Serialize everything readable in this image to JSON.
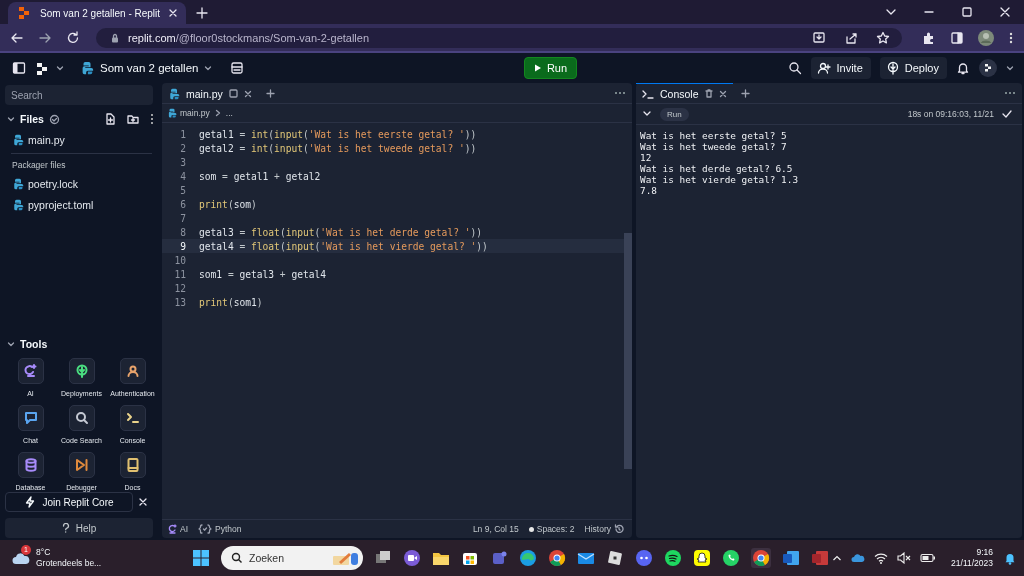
{
  "browser": {
    "tab_title": "Som van 2 getallen - Replit",
    "url_host": "replit.com",
    "url_path": "/@floor0stockmans/Som-van-2-getallen"
  },
  "header": {
    "project": "Som van 2 getallen",
    "run_button": "Run",
    "invite_button": "Invite",
    "deploy_button": "Deploy"
  },
  "sidebar": {
    "search_placeholder": "Search",
    "files_title": "Files",
    "files": [
      {
        "name": "main.py"
      }
    ],
    "packager_title": "Packager files",
    "packager_files": [
      {
        "name": "poetry.lock"
      },
      {
        "name": "pyproject.toml"
      }
    ],
    "tools_title": "Tools",
    "tools": [
      {
        "label": "AI",
        "kind": "ai",
        "color": "#a78bfa"
      },
      {
        "label": "Deployments",
        "kind": "deployments",
        "color": "#4ade80"
      },
      {
        "label": "Authentication",
        "kind": "authentication",
        "color": "#e8a36b"
      },
      {
        "label": "Chat",
        "kind": "chat",
        "color": "#5aa5f0"
      },
      {
        "label": "Code Search",
        "kind": "search",
        "color": "#c5c9d3"
      },
      {
        "label": "Console",
        "kind": "console",
        "color": "#e9d28a"
      },
      {
        "label": "Database",
        "kind": "database",
        "color": "#a78bfa"
      },
      {
        "label": "Debugger",
        "kind": "debugger",
        "color": "#e08a3c"
      },
      {
        "label": "Docs",
        "kind": "docs",
        "color": "#e0c070"
      }
    ],
    "join_button": "Join Replit Core",
    "help_button": "Help"
  },
  "editor": {
    "tab": "main.py",
    "breadcrumb_file": "main.py",
    "breadcrumb_more": "...",
    "lines": [
      {
        "number": "1",
        "current": false,
        "tokens": [
          {
            "text": "getal1",
            "kind": "name"
          },
          {
            "text": " = ",
            "kind": "op"
          },
          {
            "text": "int",
            "kind": "func"
          },
          {
            "text": "(",
            "kind": "op"
          },
          {
            "text": "input",
            "kind": "func"
          },
          {
            "text": "(",
            "kind": "op"
          },
          {
            "text": "'Wat is het eerste getal? '",
            "kind": "string"
          },
          {
            "text": "))",
            "kind": "op"
          }
        ]
      },
      {
        "number": "2",
        "current": false,
        "tokens": [
          {
            "text": "getal2",
            "kind": "name"
          },
          {
            "text": " = ",
            "kind": "op"
          },
          {
            "text": "int",
            "kind": "func"
          },
          {
            "text": "(",
            "kind": "op"
          },
          {
            "text": "input",
            "kind": "func"
          },
          {
            "text": "(",
            "kind": "op"
          },
          {
            "text": "'Wat is het tweede getal? '",
            "kind": "string"
          },
          {
            "text": "))",
            "kind": "op"
          }
        ]
      },
      {
        "number": "3",
        "current": false
      },
      {
        "number": "4",
        "current": false,
        "tokens": [
          {
            "text": "som",
            "kind": "name"
          },
          {
            "text": " = ",
            "kind": "op"
          },
          {
            "text": "getal1",
            "kind": "name"
          },
          {
            "text": " + ",
            "kind": "op"
          },
          {
            "text": "getal2",
            "kind": "name"
          }
        ]
      },
      {
        "number": "5",
        "current": false
      },
      {
        "number": "6",
        "current": false,
        "tokens": [
          {
            "text": "print",
            "kind": "func"
          },
          {
            "text": "(",
            "kind": "op"
          },
          {
            "text": "som",
            "kind": "name"
          },
          {
            "text": ")",
            "kind": "op"
          }
        ]
      },
      {
        "number": "7",
        "current": false
      },
      {
        "number": "8",
        "current": false,
        "tokens": [
          {
            "text": "getal3",
            "kind": "name"
          },
          {
            "text": " = ",
            "kind": "op"
          },
          {
            "text": "float",
            "kind": "func"
          },
          {
            "text": "(",
            "kind": "op"
          },
          {
            "text": "input",
            "kind": "func"
          },
          {
            "text": "(",
            "kind": "op"
          },
          {
            "text": "'Wat is het derde getal? '",
            "kind": "string"
          },
          {
            "text": "))",
            "kind": "op"
          }
        ]
      },
      {
        "number": "9",
        "current": true,
        "tokens": [
          {
            "text": "getal4",
            "kind": "name"
          },
          {
            "text": " = ",
            "kind": "op"
          },
          {
            "text": "float",
            "kind": "func"
          },
          {
            "text": "(",
            "kind": "op"
          },
          {
            "text": "input",
            "kind": "func"
          },
          {
            "text": "(",
            "kind": "op"
          },
          {
            "text": "'Wat is het vierde getal? '",
            "kind": "string"
          },
          {
            "text": "))",
            "kind": "op"
          }
        ]
      },
      {
        "number": "10",
        "current": false
      },
      {
        "number": "11",
        "current": false,
        "tokens": [
          {
            "text": "som1",
            "kind": "name"
          },
          {
            "text": " = ",
            "kind": "op"
          },
          {
            "text": "getal3",
            "kind": "name"
          },
          {
            "text": " + ",
            "kind": "op"
          },
          {
            "text": "getal4",
            "kind": "name"
          }
        ]
      },
      {
        "number": "12",
        "current": false
      },
      {
        "number": "13",
        "current": false,
        "tokens": [
          {
            "text": "print",
            "kind": "func"
          },
          {
            "text": "(",
            "kind": "op"
          },
          {
            "text": "som1",
            "kind": "name"
          },
          {
            "text": ")",
            "kind": "op"
          }
        ]
      }
    ],
    "status": {
      "ai": "AI",
      "language": "Python",
      "position": "Ln 9, Col 15",
      "spaces": "Spaces: 2",
      "history": "History"
    }
  },
  "console": {
    "tab": "Console",
    "run_chip": "Run",
    "run_info": "18s on 09:16:03, 11/21",
    "output": [
      "Wat is het eerste getal? 5",
      "Wat is het tweede getal? 7",
      "12",
      "Wat is het derde getal? 6.5",
      "Wat is het vierde getal? 1.3",
      "7.8"
    ]
  },
  "taskbar": {
    "weather_badge": "1",
    "temperature": "8°C",
    "weather_text": "Grotendeels be...",
    "search_placeholder": "Zoeken",
    "time": "9:16",
    "date": "21/11/2023"
  }
}
